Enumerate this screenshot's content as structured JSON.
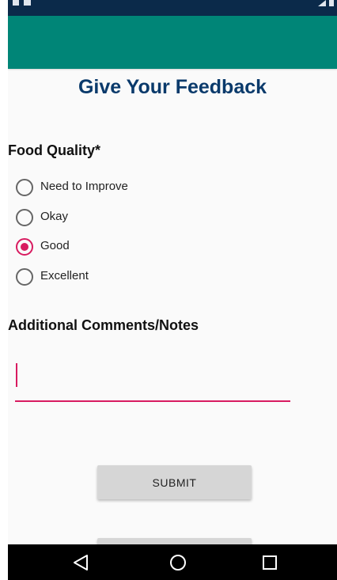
{
  "page": {
    "title": "Give Your Feedback"
  },
  "food_quality": {
    "label": "Food Quality*",
    "options": [
      {
        "label": "Need to Improve",
        "checked": false
      },
      {
        "label": "Okay",
        "checked": false
      },
      {
        "label": "Good",
        "checked": true
      },
      {
        "label": "Excellent",
        "checked": false
      }
    ]
  },
  "comments": {
    "label": "Additional Comments/Notes",
    "value": ""
  },
  "buttons": {
    "submit_label": "SUBMIT",
    "second_label": ""
  },
  "nav": {
    "back_icon": "back-triangle-icon",
    "home_icon": "home-circle-icon",
    "recent_icon": "recent-apps-square-icon"
  },
  "colors": {
    "app_bar": "#008577",
    "status_bar": "#0b2a4a",
    "accent": "#d81b60",
    "title": "#0a3a6b"
  }
}
